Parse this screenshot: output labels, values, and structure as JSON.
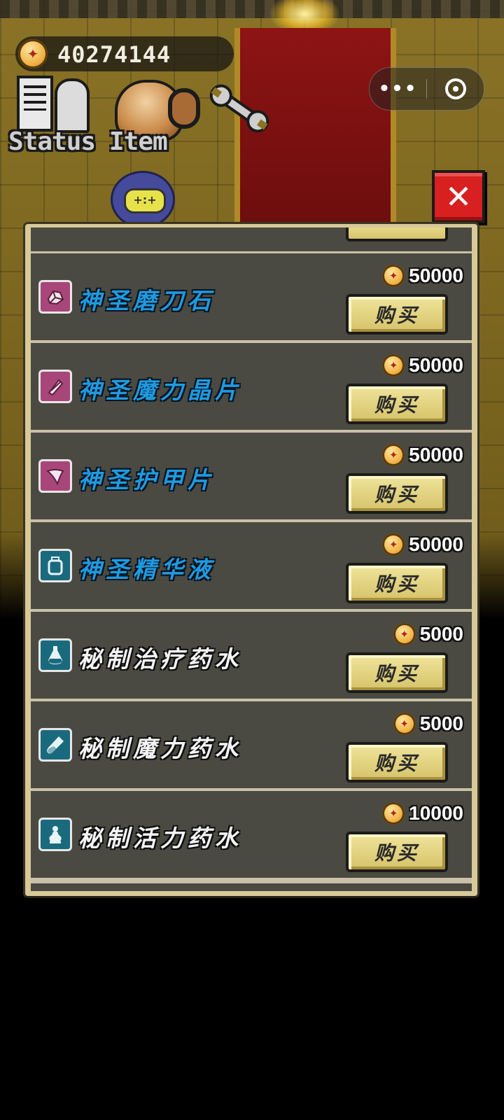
{
  "hud": {
    "gold_amount": "40274144",
    "status_label": "Status",
    "item_label": "Item"
  },
  "mini_program": {
    "more_glyph": "•••",
    "close_glyph": "◎"
  },
  "close_button_glyph": "✕",
  "buy_label": "购买",
  "shop_items": [
    {
      "name": "神圣磨刀石",
      "price": "50000",
      "name_color": "blue",
      "icon": "whetstone-icon",
      "icon_bg": "pink"
    },
    {
      "name": "神圣魔力晶片",
      "price": "50000",
      "name_color": "blue",
      "icon": "crystal-shard-icon",
      "icon_bg": "pink"
    },
    {
      "name": "神圣护甲片",
      "price": "50000",
      "name_color": "blue",
      "icon": "armor-plate-icon",
      "icon_bg": "pink"
    },
    {
      "name": "神圣精华液",
      "price": "50000",
      "name_color": "blue",
      "icon": "essence-jar-icon",
      "icon_bg": "teal"
    },
    {
      "name": "秘制治疗药水",
      "price": "5000",
      "name_color": "white",
      "icon": "heal-potion-icon",
      "icon_bg": "teal"
    },
    {
      "name": "秘制魔力药水",
      "price": "5000",
      "name_color": "white",
      "icon": "mana-potion-icon",
      "icon_bg": "teal"
    },
    {
      "name": "秘制活力药水",
      "price": "10000",
      "name_color": "white",
      "icon": "vitality-potion-icon",
      "icon_bg": "teal"
    }
  ],
  "colors": {
    "name_blue": "#1f9ae0",
    "icon_pink": "#a8467a",
    "icon_teal": "#1a6a7e",
    "row_bg": "#4a4a42",
    "buy_button": "#e6d68a",
    "close_red": "#d82020"
  }
}
